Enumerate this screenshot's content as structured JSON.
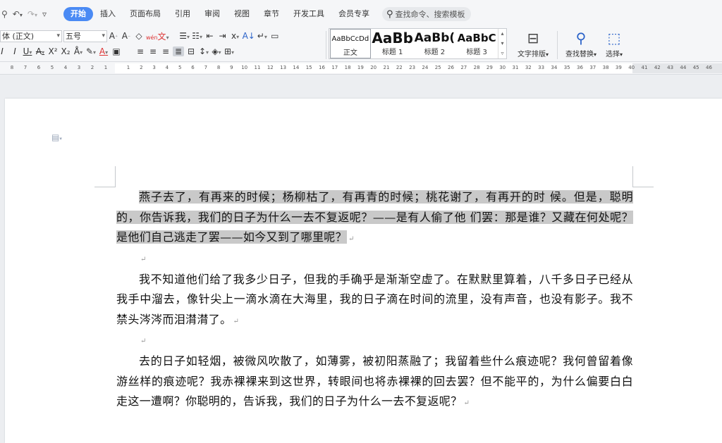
{
  "menu": {
    "quick_icons": [
      "search-icon",
      "undo-icon",
      "redo-icon",
      "customize-icon"
    ],
    "tabs": [
      {
        "label": "开始",
        "active": true
      },
      {
        "label": "插入",
        "active": false
      },
      {
        "label": "页面布局",
        "active": false
      },
      {
        "label": "引用",
        "active": false
      },
      {
        "label": "审阅",
        "active": false
      },
      {
        "label": "视图",
        "active": false
      },
      {
        "label": "章节",
        "active": false
      },
      {
        "label": "开发工具",
        "active": false
      },
      {
        "label": "会员专享",
        "active": false
      }
    ],
    "search_placeholder": "查找命令、搜索模板"
  },
  "ribbon": {
    "font_name": "体 (正文)",
    "font_size": "五号",
    "wen_label": "wén",
    "styles": [
      {
        "preview": "AaBbCcDd",
        "label": "正文"
      },
      {
        "preview": "AaBb",
        "label": "标题 1"
      },
      {
        "preview": "AaBb(",
        "label": "标题 2"
      },
      {
        "preview": "AaBbC",
        "label": "标题 3"
      }
    ],
    "text_layout_label": "文字排版",
    "find_replace_label": "查找替换",
    "select_label": "选择"
  },
  "ruler": {
    "left_numbers": [
      "8",
      "7",
      "6",
      "5",
      "4",
      "3",
      "2",
      "1"
    ],
    "numbers": [
      "1",
      "2",
      "3",
      "4",
      "5",
      "6",
      "7",
      "8",
      "9",
      "10",
      "11",
      "12",
      "13",
      "14",
      "15",
      "16",
      "17",
      "18",
      "19",
      "20",
      "21",
      "22",
      "23",
      "24",
      "25",
      "26",
      "27",
      "28",
      "29",
      "30",
      "31",
      "32",
      "33",
      "34",
      "35",
      "36",
      "37",
      "38",
      "39",
      "40",
      "41",
      "42",
      "43",
      "44",
      "45",
      "46"
    ]
  },
  "document": {
    "paragraph1": "燕子去了，有再来的时候；杨柳枯了，有再青的时候；桃花谢了，有再开的时 候。但是，聪明的，你告诉我，我们的日子为什么一去不复返呢？——是有人偷了他 们罢：那是谁？又藏在何处呢？是他们自己逃走了罢——如今又到了哪里呢？",
    "paragraph2": "我不知道他们给了我多少日子，但我的手确乎是渐渐空虚了。在默默里算着，八千多日子已经从我手中溜去，像针尖上一滴水滴在大海里，我的日子滴在时间的流里，没有声音，也没有影子。我不禁头涔涔而泪潸潸了。",
    "paragraph3": "去的日子如轻烟，被微风吹散了，如薄雾，被初阳蒸融了；我留着些什么痕迹呢？我何曾留着像游丝样的痕迹呢？我赤裸裸来到这世界，转眼间也将赤裸裸的回去罢？但不能平的，为什么偏要白白走这一遭啊？你聪明的，告诉我，我们的日子为什么一去不复返呢？",
    "paragraph_mark": "↵"
  }
}
